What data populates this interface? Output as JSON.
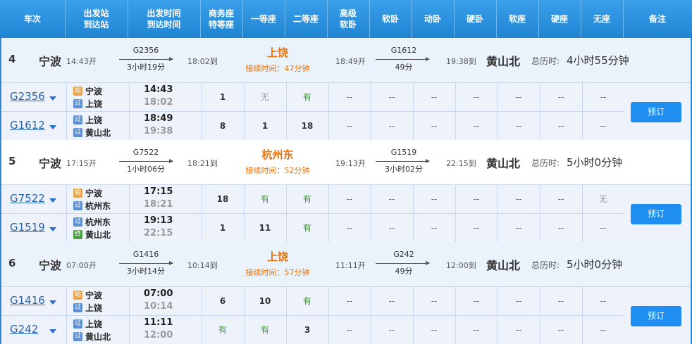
{
  "headers": [
    {
      "l1": "车次",
      "l2": ""
    },
    {
      "l1": "出发站",
      "l2": "到达站"
    },
    {
      "l1": "出发时间",
      "l2": "到达时间"
    },
    {
      "l1": "商务座",
      "l2": "特等座"
    },
    {
      "l1": "一等座",
      "l2": ""
    },
    {
      "l1": "二等座",
      "l2": ""
    },
    {
      "l1": "高级",
      "l2": "软卧"
    },
    {
      "l1": "软卧",
      "l2": ""
    },
    {
      "l1": "动卧",
      "l2": ""
    },
    {
      "l1": "硬卧",
      "l2": ""
    },
    {
      "l1": "软座",
      "l2": ""
    },
    {
      "l1": "硬座",
      "l2": ""
    },
    {
      "l1": "无座",
      "l2": ""
    },
    {
      "l1": "备注",
      "l2": ""
    }
  ],
  "book_label": "预订",
  "total_label": "总历时:",
  "groups": [
    {
      "index": "4",
      "from_city": "宁波",
      "from_time": "14:43开",
      "leg1_train": "G2356",
      "leg1_duration": "3小时19分",
      "leg1_arrive": "18:02到",
      "transfer_city": "上饶",
      "transfer_wait": "接续时间：47分钟",
      "leg2_depart": "18:49开",
      "leg2_train": "G1612",
      "leg2_duration": "49分",
      "leg2_arrive": "19:38到",
      "dest_city": "黄山北",
      "total": "4小时55分钟",
      "trains": [
        {
          "no": "G2356",
          "from": {
            "badge": "始",
            "name": "宁波"
          },
          "to": {
            "badge": "过",
            "name": "上饶"
          },
          "dep": "14:43",
          "arr": "18:02",
          "seats": [
            "1",
            "无",
            "有",
            "--",
            "--",
            "--",
            "--",
            "--",
            "--",
            "--"
          ]
        },
        {
          "no": "G1612",
          "from": {
            "badge": "过",
            "name": "上饶"
          },
          "to": {
            "badge": "过",
            "name": "黄山北"
          },
          "dep": "18:49",
          "arr": "19:38",
          "seats": [
            "8",
            "1",
            "18",
            "--",
            "--",
            "--",
            "--",
            "--",
            "--",
            "--"
          ]
        }
      ]
    },
    {
      "index": "5",
      "from_city": "宁波",
      "from_time": "17:15开",
      "leg1_train": "G7522",
      "leg1_duration": "1小时06分",
      "leg1_arrive": "18:21到",
      "transfer_city": "杭州东",
      "transfer_wait": "接续时间：52分钟",
      "leg2_depart": "19:13开",
      "leg2_train": "G1519",
      "leg2_duration": "3小时02分",
      "leg2_arrive": "22:15到",
      "dest_city": "黄山北",
      "total": "5小时0分钟",
      "trains": [
        {
          "no": "G7522",
          "from": {
            "badge": "始",
            "name": "宁波"
          },
          "to": {
            "badge": "过",
            "name": "杭州东"
          },
          "dep": "17:15",
          "arr": "18:21",
          "seats": [
            "18",
            "有",
            "有",
            "--",
            "--",
            "--",
            "--",
            "--",
            "--",
            "无"
          ]
        },
        {
          "no": "G1519",
          "from": {
            "badge": "过",
            "name": "杭州东"
          },
          "to": {
            "badge": "终",
            "name": "黄山北"
          },
          "dep": "19:13",
          "arr": "22:15",
          "seats": [
            "1",
            "11",
            "有",
            "--",
            "--",
            "--",
            "--",
            "--",
            "--",
            "--"
          ]
        }
      ]
    },
    {
      "index": "6",
      "from_city": "宁波",
      "from_time": "07:00开",
      "leg1_train": "G1416",
      "leg1_duration": "3小时14分",
      "leg1_arrive": "10:14到",
      "transfer_city": "上饶",
      "transfer_wait": "接续时间：57分钟",
      "leg2_depart": "11:11开",
      "leg2_train": "G242",
      "leg2_duration": "49分",
      "leg2_arrive": "12:00到",
      "dest_city": "黄山北",
      "total": "5小时0分钟",
      "trains": [
        {
          "no": "G1416",
          "from": {
            "badge": "始",
            "name": "宁波"
          },
          "to": {
            "badge": "过",
            "name": "上饶"
          },
          "dep": "07:00",
          "arr": "10:14",
          "seats": [
            "6",
            "10",
            "有",
            "--",
            "--",
            "--",
            "--",
            "--",
            "--",
            "--"
          ]
        },
        {
          "no": "G242",
          "from": {
            "badge": "过",
            "name": "上饶"
          },
          "to": {
            "badge": "过",
            "name": "黄山北"
          },
          "dep": "11:11",
          "arr": "12:00",
          "seats": [
            "有",
            "有",
            "3",
            "--",
            "--",
            "--",
            "--",
            "--",
            "--",
            "--"
          ]
        }
      ]
    }
  ]
}
